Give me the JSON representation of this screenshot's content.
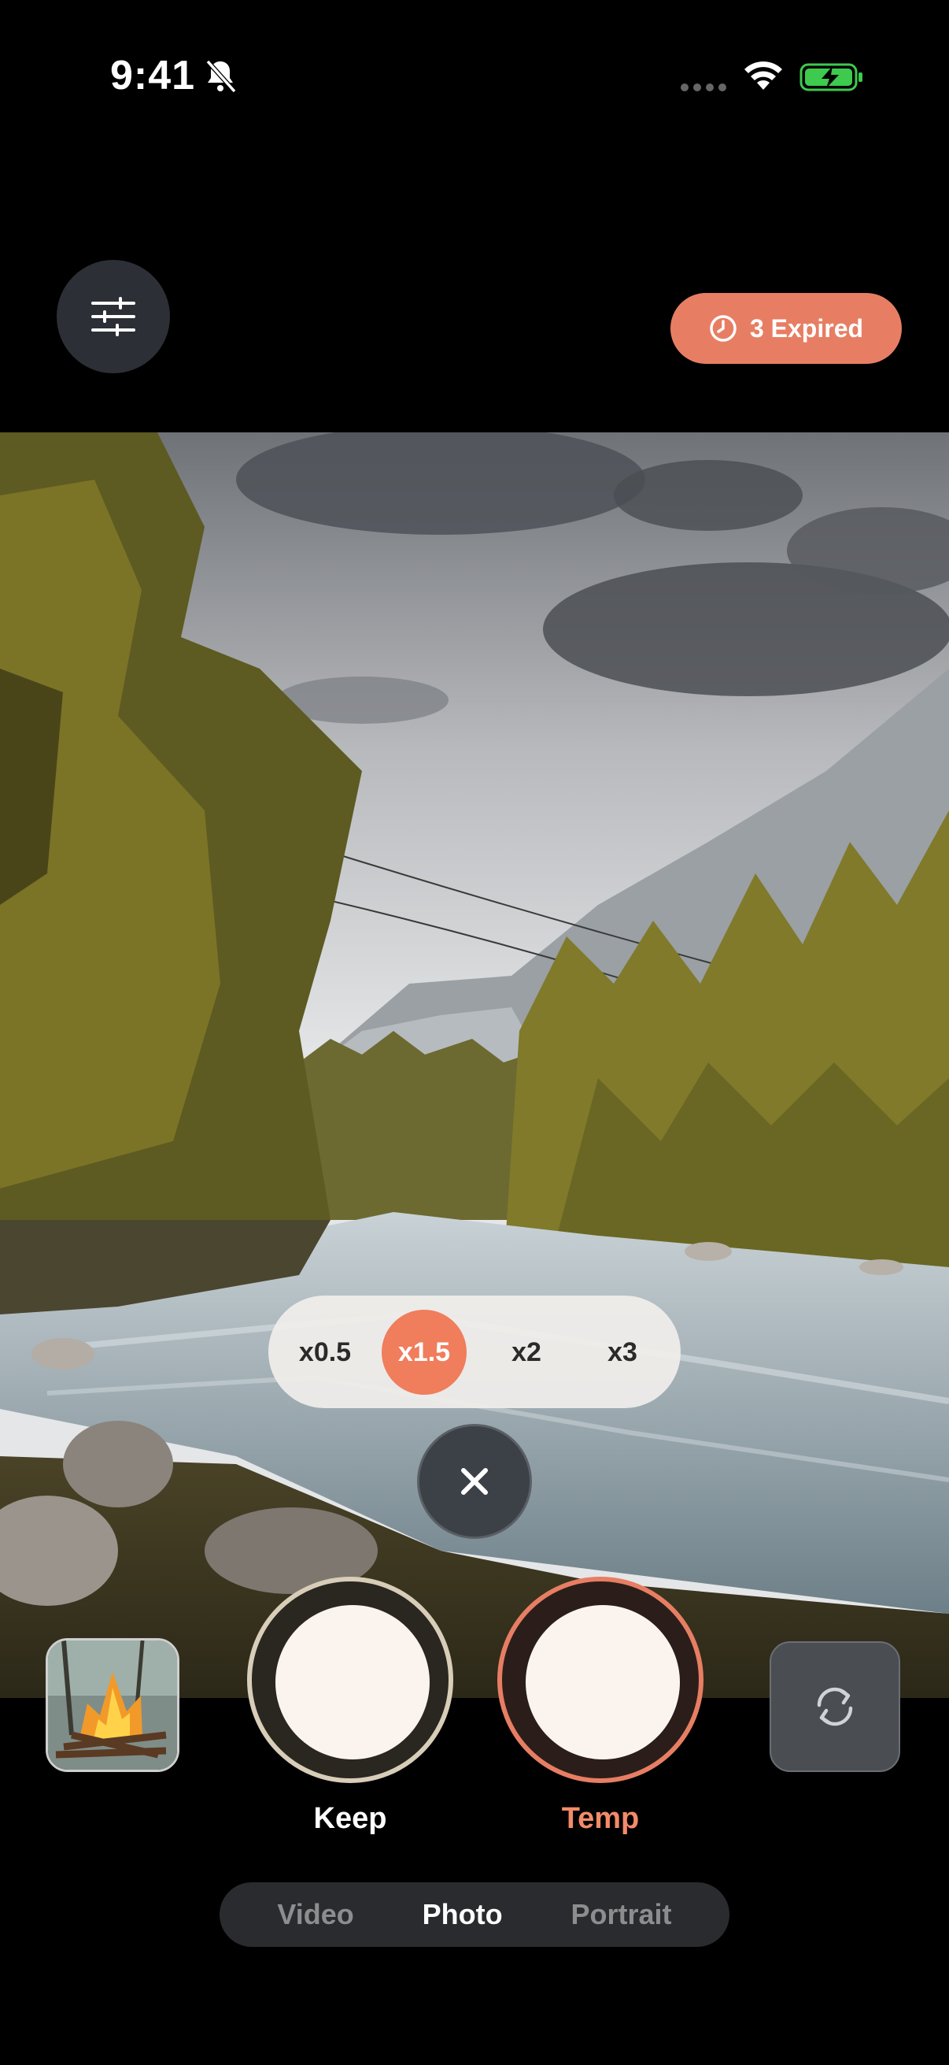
{
  "status_bar": {
    "time": "9:41"
  },
  "top": {
    "expired_label": "3 Expired"
  },
  "zoom": {
    "options": [
      "x0.5",
      "x1.5",
      "x2",
      "x3"
    ],
    "selected": "x1.5"
  },
  "shutters": {
    "keep_label": "Keep",
    "temp_label": "Temp"
  },
  "modes": {
    "items": [
      "Video",
      "Photo",
      "Portrait"
    ],
    "active": "Photo"
  },
  "colors": {
    "accent": "#E77E63",
    "background": "#000000",
    "control_dark": "#2C3036"
  }
}
